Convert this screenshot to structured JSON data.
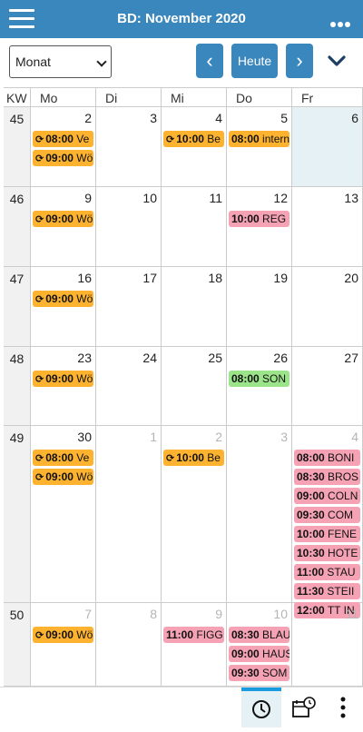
{
  "app": {
    "title": "BD: November 2020"
  },
  "toolbar": {
    "view": "Monat",
    "today_label": "Heute",
    "prev_glyph": "‹",
    "next_glyph": "›"
  },
  "headers": {
    "kw": "KW",
    "days": [
      "Mo",
      "Di",
      "Mi",
      "Do",
      "Fr"
    ]
  },
  "rec_glyph": "⟳",
  "weeks": [
    {
      "kw": "45",
      "days": [
        {
          "num": "2",
          "events": [
            {
              "time": "08:00",
              "text": "Ve",
              "color": "orange",
              "rec": true
            },
            {
              "time": "09:00",
              "text": "Wö",
              "color": "orange",
              "rec": true
            }
          ]
        },
        {
          "num": "3",
          "events": []
        },
        {
          "num": "4",
          "events": [
            {
              "time": "10:00",
              "text": "Be",
              "color": "orange",
              "rec": true
            }
          ]
        },
        {
          "num": "5",
          "events": [
            {
              "time": "08:00",
              "text": "intern",
              "color": "orange",
              "rec": false
            }
          ]
        },
        {
          "num": "6",
          "today": true,
          "events": []
        }
      ]
    },
    {
      "kw": "46",
      "days": [
        {
          "num": "9",
          "events": [
            {
              "time": "09:00",
              "text": "Wö",
              "color": "orange",
              "rec": true
            }
          ]
        },
        {
          "num": "10",
          "events": []
        },
        {
          "num": "11",
          "events": []
        },
        {
          "num": "12",
          "events": [
            {
              "time": "10:00",
              "text": "REG",
              "color": "pink",
              "rec": false
            }
          ]
        },
        {
          "num": "13",
          "events": []
        }
      ]
    },
    {
      "kw": "47",
      "days": [
        {
          "num": "16",
          "events": [
            {
              "time": "09:00",
              "text": "Wö",
              "color": "orange",
              "rec": true
            }
          ]
        },
        {
          "num": "17",
          "events": []
        },
        {
          "num": "18",
          "events": []
        },
        {
          "num": "19",
          "events": []
        },
        {
          "num": "20",
          "events": []
        }
      ]
    },
    {
      "kw": "48",
      "days": [
        {
          "num": "23",
          "events": [
            {
              "time": "09:00",
              "text": "Wö",
              "color": "orange",
              "rec": true
            }
          ]
        },
        {
          "num": "24",
          "events": []
        },
        {
          "num": "25",
          "events": []
        },
        {
          "num": "26",
          "events": [
            {
              "time": "08:00",
              "text": "SON",
              "color": "green",
              "rec": false
            }
          ]
        },
        {
          "num": "27",
          "events": []
        }
      ]
    },
    {
      "kw": "49",
      "days": [
        {
          "num": "30",
          "events": [
            {
              "time": "08:00",
              "text": "Ve",
              "color": "orange",
              "rec": true
            },
            {
              "time": "09:00",
              "text": "Wö",
              "color": "orange",
              "rec": true
            }
          ]
        },
        {
          "num": "1",
          "other": true,
          "events": []
        },
        {
          "num": "2",
          "other": true,
          "events": [
            {
              "time": "10:00",
              "text": "Be",
              "color": "orange",
              "rec": true
            }
          ]
        },
        {
          "num": "3",
          "other": true,
          "events": []
        },
        {
          "num": "4",
          "other": true,
          "events": [
            {
              "time": "08:00",
              "text": "BONI",
              "color": "pink",
              "rec": false
            },
            {
              "time": "08:30",
              "text": "BROS",
              "color": "pink",
              "rec": false
            },
            {
              "time": "09:00",
              "text": "COLN",
              "color": "pink",
              "rec": false
            },
            {
              "time": "09:30",
              "text": "COM",
              "color": "pink",
              "rec": false
            },
            {
              "time": "10:00",
              "text": "FENE",
              "color": "pink",
              "rec": false
            },
            {
              "time": "10:30",
              "text": "HOTE",
              "color": "pink",
              "rec": false
            },
            {
              "time": "11:00",
              "text": "STAU",
              "color": "pink",
              "rec": false
            },
            {
              "time": "11:30",
              "text": "STEII",
              "color": "pink",
              "rec": false
            },
            {
              "time": "12:00",
              "text": "TT IN",
              "color": "pink",
              "rec": false
            }
          ]
        }
      ]
    },
    {
      "kw": "50",
      "days": [
        {
          "num": "7",
          "other": true,
          "events": [
            {
              "time": "09:00",
              "text": "Wö",
              "color": "orange",
              "rec": true
            }
          ]
        },
        {
          "num": "8",
          "other": true,
          "events": []
        },
        {
          "num": "9",
          "other": true,
          "events": [
            {
              "time": "11:00",
              "text": "FIGG",
              "color": "pink",
              "rec": false
            }
          ]
        },
        {
          "num": "10",
          "other": true,
          "events": [
            {
              "time": "08:30",
              "text": "BLAU",
              "color": "pink",
              "rec": false
            },
            {
              "time": "09:00",
              "text": "HAUS",
              "color": "pink",
              "rec": false
            },
            {
              "time": "09:30",
              "text": "SOM",
              "color": "pink",
              "rec": false
            }
          ]
        },
        {
          "num": "11",
          "other": true,
          "events": []
        }
      ]
    }
  ]
}
